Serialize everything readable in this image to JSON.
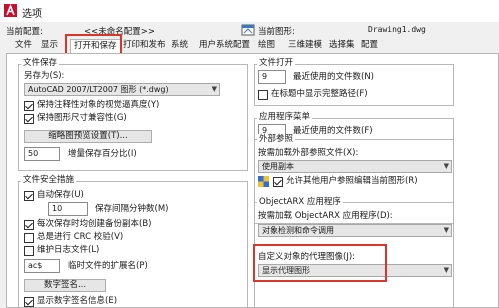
{
  "window": {
    "title": "选项",
    "logo": "autocad-a-logo"
  },
  "profile": {
    "current_config_label": "当前配置:",
    "current_config_value": "<<未命名配置>>",
    "current_drawing_label": "当前图形:",
    "current_drawing_value": "Drawing1.dwg"
  },
  "tabs": [
    {
      "label": "文件"
    },
    {
      "label": "显示"
    },
    {
      "label": "打开和保存",
      "active": true
    },
    {
      "label": "打印和发布"
    },
    {
      "label": "系统"
    },
    {
      "label": "用户系统配置"
    },
    {
      "label": "绘图"
    },
    {
      "label": "三维建模"
    },
    {
      "label": "选择集"
    },
    {
      "label": "配置"
    }
  ],
  "file_save": {
    "group_title": "文件保存",
    "save_as_label": "另存为(S):",
    "save_as_value": "AutoCAD 2007/LT2007 图形 (*.dwg)",
    "keep_annotative_fidelity": {
      "label": "保持注释性对象的视觉逼真度(Y)",
      "checked": true
    },
    "keep_drawing_size_compat": {
      "label": "保持图形尺寸兼容性(G)",
      "checked": true
    },
    "thumbnail_button": "缩略图预览设置(T)...",
    "incremental_save_value": "50",
    "incremental_save_label": "增量保存百分比(I)"
  },
  "file_safety": {
    "group_title": "文件安全措施",
    "autosave": {
      "label": "自动保存(U)",
      "checked": true
    },
    "autosave_minutes_value": "10",
    "autosave_minutes_label": "保存间隔分钟数(M)",
    "backup_copy": {
      "label": "每次保存时均创建备份副本(B)",
      "checked": true
    },
    "crc_check": {
      "label": "总是进行 CRC 校验(V)",
      "checked": false
    },
    "log_file": {
      "label": "维护日志文件(L)",
      "checked": false
    },
    "temp_ext_value": "ac$",
    "temp_ext_label": "临时文件的扩展名(P)",
    "digital_sign_button": "数字签名...",
    "show_sign_info_label": "显示数字签名信息(E)"
  },
  "file_open": {
    "group_title": "文件打开",
    "recent_files_value": "9",
    "recent_files_label": "最近使用的文件数(N)",
    "show_full_path": {
      "label": "在标题中显示完整路径(F)",
      "checked": false
    }
  },
  "app_menu": {
    "group_title": "应用程序菜单",
    "recent_files_value": "9",
    "recent_files_label": "最近使用的文件数(F)"
  },
  "xref": {
    "group_title": "外部参照",
    "demand_load_label": "按需加载外部参照文件(X):",
    "demand_load_value": "使用副本",
    "allow_edit": {
      "label": "允许其他用户参照编辑当前图形(R)",
      "checked": true
    }
  },
  "objectarx": {
    "group_title": "ObjectARX 应用程序",
    "demand_load_label": "按需加载 ObjectARX 应用程序(D):",
    "demand_load_value": "对象检测和命令调用",
    "proxy_image_label": "自定义对象的代理图像(J):",
    "proxy_image_value": "显示代理图形"
  },
  "highlight_color": "#d9352a"
}
